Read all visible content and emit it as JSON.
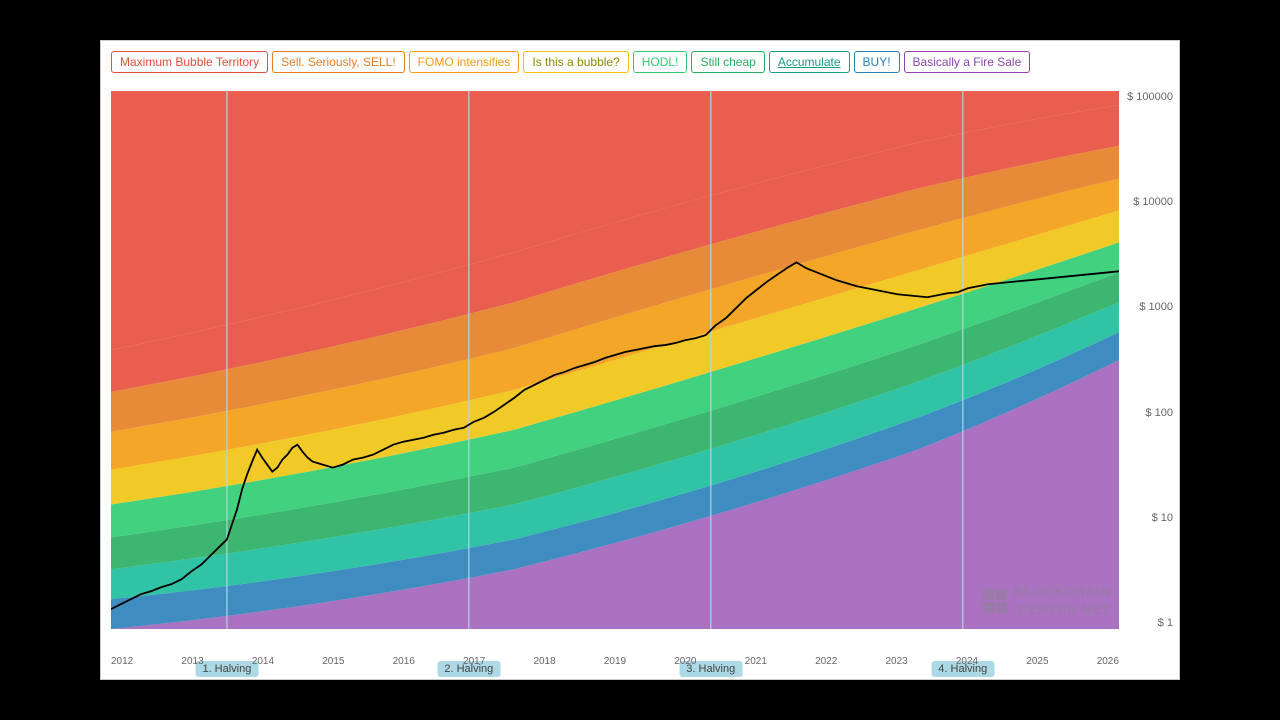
{
  "legend": [
    {
      "label": "Maximum Bubble Territory",
      "color": "#e74c3c",
      "border": "#e74c3c",
      "bg": "#fff",
      "textColor": "#e74c3c"
    },
    {
      "label": "Sell. Seriously, SELL!",
      "color": "#e67e22",
      "border": "#e67e22",
      "bg": "#fff",
      "textColor": "#e67e22"
    },
    {
      "label": "FOMO intensifies",
      "color": "#f39c12",
      "border": "#f39c12",
      "bg": "#fff",
      "textColor": "#f39c12"
    },
    {
      "label": "Is this a bubble?",
      "color": "#f1c40f",
      "border": "#f1c40f",
      "bg": "#fff",
      "textColor": "#888800"
    },
    {
      "label": "HODL!",
      "color": "#2ecc71",
      "border": "#2ecc71",
      "bg": "#fff",
      "textColor": "#2ecc71"
    },
    {
      "label": "Still cheap",
      "color": "#27ae60",
      "border": "#27ae60",
      "bg": "#fff",
      "textColor": "#27ae60"
    },
    {
      "label": "Accumulate",
      "color": "#16a085",
      "border": "#16a085",
      "bg": "#fff",
      "textColor": "#16a085",
      "underline": true
    },
    {
      "label": "BUY!",
      "color": "#2980b9",
      "border": "#2980b9",
      "bg": "#fff",
      "textColor": "#2980b9"
    },
    {
      "label": "Basically a Fire Sale",
      "color": "#8e44ad",
      "border": "#8e44ad",
      "bg": "#fff",
      "textColor": "#8e44ad"
    }
  ],
  "halvings": [
    {
      "label": "1. Halving",
      "pct": 0.115
    },
    {
      "label": "2. Halving",
      "pct": 0.355
    },
    {
      "label": "3. Halving",
      "pct": 0.595
    },
    {
      "label": "4. Halving",
      "pct": 0.845
    }
  ],
  "y_labels": [
    "$ 100000",
    "$ 10000",
    "$ 1000",
    "$ 100",
    "$ 10",
    "$ 1"
  ],
  "x_labels": [
    "2012",
    "2013",
    "2014",
    "2015",
    "2016",
    "2017",
    "2018",
    "2019",
    "2020",
    "2021",
    "2022",
    "2023",
    "2024",
    "2025",
    "2026"
  ],
  "watermark_line1": "BLOCKCHAIN",
  "watermark_line2": "CENTER.NET"
}
